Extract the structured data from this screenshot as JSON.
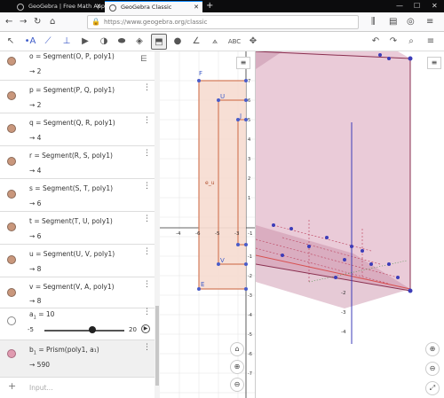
{
  "browser": {
    "tabs": [
      {
        "title": "GeoGebra | Free Math Apps - u",
        "active": false
      },
      {
        "title": "GeoGebra Classic",
        "active": true
      }
    ],
    "url": "https://www.geogebra.org/classic"
  },
  "algebra": {
    "rows": [
      {
        "def": "o = Segment(O, P, poly1)",
        "val": "→  2"
      },
      {
        "def": "p = Segment(P, Q, poly1)",
        "val": "→  2"
      },
      {
        "def": "q = Segment(Q, R, poly1)",
        "val": "→  4"
      },
      {
        "def": "r = Segment(R, S, poly1)",
        "val": "→  4"
      },
      {
        "def": "s = Segment(S, T, poly1)",
        "val": "→  6"
      },
      {
        "def": "t = Segment(T, U, poly1)",
        "val": "→  6"
      },
      {
        "def": "u = Segment(U, V, poly1)",
        "val": "→  8"
      },
      {
        "def": "v = Segment(V, A, poly1)",
        "val": "→  8"
      }
    ],
    "slider": {
      "name": "a",
      "sub": "1",
      "value": "= 10",
      "min": "-5",
      "max": "20",
      "level": 0.6
    },
    "prism": {
      "name": "b",
      "sub": "1",
      "def": "= Prism(poly1, a₁)",
      "val": "→  590"
    },
    "input_placeholder": "Input..."
  },
  "graphics2d": {
    "point_labels": [
      "F",
      "U",
      "J",
      "V",
      "E"
    ],
    "polygon_label": "e_u",
    "x_ticks": [
      "-4",
      "-6",
      "-5",
      "-3",
      "-1"
    ],
    "y_ticks": [
      "7",
      "6",
      "5",
      "4",
      "3",
      "2",
      "1",
      "-1",
      "-2",
      "-3",
      "-4",
      "-5",
      "-6",
      "-7"
    ]
  },
  "graphics3d": {
    "axis_ticks": [
      "-2",
      "-3",
      "-4"
    ]
  },
  "colors": {
    "segment_dot": "#c9977c",
    "prism_dot": "#e09bb0",
    "prism_fill": "#d8a0b8",
    "polygon_fill": "#f6dcd0",
    "segment_line": "#d47c5c"
  }
}
